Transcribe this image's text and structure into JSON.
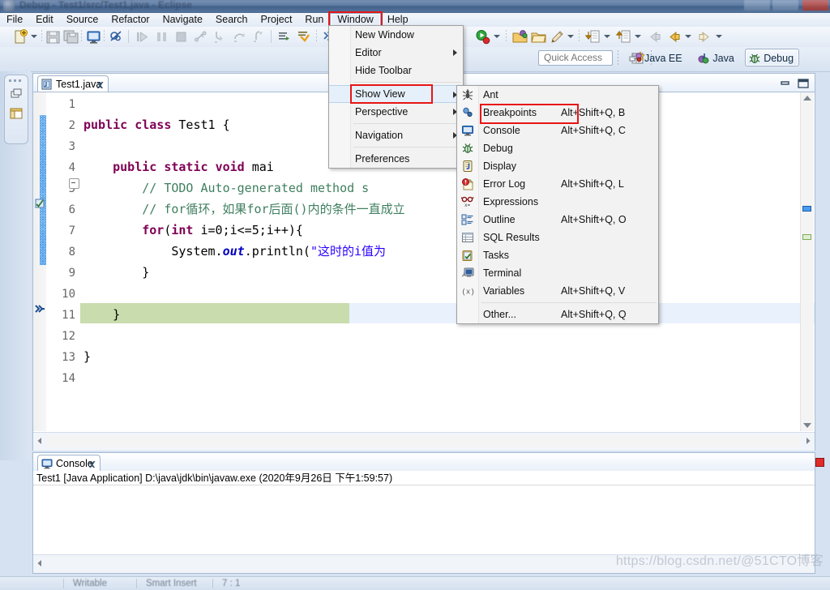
{
  "window": {
    "title": "Debug - Test1/src/Test1.java - Eclipse"
  },
  "menubar": {
    "items": [
      {
        "label": "File"
      },
      {
        "label": "Edit"
      },
      {
        "label": "Source"
      },
      {
        "label": "Refactor"
      },
      {
        "label": "Navigate"
      },
      {
        "label": "Search"
      },
      {
        "label": "Project"
      },
      {
        "label": "Run"
      },
      {
        "label": "Window"
      },
      {
        "label": "Help"
      }
    ]
  },
  "toolbar": {
    "quick_access_placeholder": "Quick Access"
  },
  "perspectives": {
    "items": [
      {
        "label": "Java EE",
        "selected": false
      },
      {
        "label": "Java",
        "selected": false
      },
      {
        "label": "Debug",
        "selected": true
      }
    ]
  },
  "window_menu": {
    "items": [
      {
        "label": "New Window",
        "submenu": false,
        "highlighted": false
      },
      {
        "label": "Editor",
        "submenu": true,
        "highlighted": false
      },
      {
        "label": "Hide Toolbar",
        "submenu": false,
        "highlighted": false
      },
      {
        "separator": true
      },
      {
        "label": "Show View",
        "submenu": true,
        "highlighted": true
      },
      {
        "label": "Perspective",
        "submenu": true,
        "highlighted": false
      },
      {
        "separator": true
      },
      {
        "label": "Navigation",
        "submenu": true,
        "highlighted": false
      },
      {
        "separator": true
      },
      {
        "label": "Preferences",
        "submenu": false,
        "highlighted": false
      }
    ]
  },
  "show_view_menu": {
    "items": [
      {
        "label": "Ant",
        "shortcut": "",
        "icon": "ant-icon",
        "highlighted": false
      },
      {
        "label": "Breakpoints",
        "shortcut": "Alt+Shift+Q, B",
        "icon": "breakpoints-icon",
        "highlighted": true
      },
      {
        "label": "Console",
        "shortcut": "Alt+Shift+Q, C",
        "icon": "console-icon",
        "highlighted": false
      },
      {
        "label": "Debug",
        "shortcut": "",
        "icon": "debug-icon",
        "highlighted": false
      },
      {
        "label": "Display",
        "shortcut": "",
        "icon": "display-icon",
        "highlighted": false
      },
      {
        "label": "Error Log",
        "shortcut": "Alt+Shift+Q, L",
        "icon": "error-log-icon",
        "highlighted": false
      },
      {
        "label": "Expressions",
        "shortcut": "",
        "icon": "expressions-icon",
        "highlighted": false
      },
      {
        "label": "Outline",
        "shortcut": "Alt+Shift+Q, O",
        "icon": "outline-icon",
        "highlighted": false
      },
      {
        "label": "SQL Results",
        "shortcut": "",
        "icon": "sql-results-icon",
        "highlighted": false
      },
      {
        "label": "Tasks",
        "shortcut": "",
        "icon": "tasks-icon",
        "highlighted": false
      },
      {
        "label": "Terminal",
        "shortcut": "",
        "icon": "terminal-icon",
        "highlighted": false
      },
      {
        "label": "Variables",
        "shortcut": "Alt+Shift+Q, V",
        "icon": "variables-icon",
        "highlighted": false
      },
      {
        "separator": true
      },
      {
        "label": "Other...",
        "shortcut": "Alt+Shift+Q, Q",
        "icon": "",
        "highlighted": false
      }
    ]
  },
  "editor": {
    "tab_label": "Test1.java",
    "line_numbers": [
      "1",
      "2",
      "3",
      "4",
      "5",
      "6",
      "7",
      "8",
      "9",
      "10",
      "11",
      "12",
      "13",
      "14"
    ],
    "code_lines": [
      {
        "n": 1,
        "segments": []
      },
      {
        "n": 2,
        "segments": [
          {
            "t": "public ",
            "c": "kw"
          },
          {
            "t": "class ",
            "c": "kw"
          },
          {
            "t": "Test1 {",
            "c": "pl"
          }
        ]
      },
      {
        "n": 3,
        "segments": []
      },
      {
        "n": 4,
        "segments": [
          {
            "t": "    ",
            "c": "pl"
          },
          {
            "t": "public ",
            "c": "kw"
          },
          {
            "t": "static ",
            "c": "kw"
          },
          {
            "t": "void ",
            "c": "kw"
          },
          {
            "t": "mai",
            "c": "pl"
          }
        ]
      },
      {
        "n": 5,
        "segments": [
          {
            "t": "        // TODO Auto-generated method s",
            "c": "cm"
          }
        ]
      },
      {
        "n": 6,
        "segments": [
          {
            "t": "        // for循环，如果for后面()内的条件一直成立",
            "c": "cm"
          }
        ]
      },
      {
        "n": 7,
        "segments": [
          {
            "t": "        ",
            "c": "pl"
          },
          {
            "t": "for",
            "c": "kw"
          },
          {
            "t": "(",
            "c": "pl"
          },
          {
            "t": "int",
            "c": "kw"
          },
          {
            "t": " i=0;i<=5;i++){",
            "c": "pl"
          }
        ]
      },
      {
        "n": 8,
        "segments": [
          {
            "t": "            System.",
            "c": "pl"
          },
          {
            "t": "out",
            "c": "fld"
          },
          {
            "t": ".println(",
            "c": "pl"
          },
          {
            "t": "\"这时的i值为",
            "c": "st"
          }
        ]
      },
      {
        "n": 9,
        "segments": [
          {
            "t": "        }",
            "c": "pl"
          }
        ]
      },
      {
        "n": 10,
        "segments": []
      },
      {
        "n": 11,
        "segments": [
          {
            "t": "    }",
            "c": "pl"
          }
        ]
      },
      {
        "n": 12,
        "segments": []
      },
      {
        "n": 13,
        "segments": [
          {
            "t": "}",
            "c": "pl"
          }
        ]
      },
      {
        "n": 14,
        "segments": []
      }
    ]
  },
  "console": {
    "tab_label": "Console",
    "launch_line": "Test1 [Java Application] D:\\java\\jdk\\bin\\javaw.exe (2020年9月26日 下午1:59:57)"
  },
  "statusbar": {
    "writable": "Writable",
    "insert_mode": "Smart Insert",
    "position": "7 : 1"
  },
  "watermark": {
    "text": "https://blog.csdn.net/@51CTO博客"
  },
  "colors": {
    "highlight_red": "#e81515",
    "selection_green": "#c9dcae",
    "cursor_line": "#e8f1fc",
    "keyword": "#7f0055",
    "comment": "#3f7f5f",
    "string": "#2a00ff",
    "field": "#0000c0"
  }
}
